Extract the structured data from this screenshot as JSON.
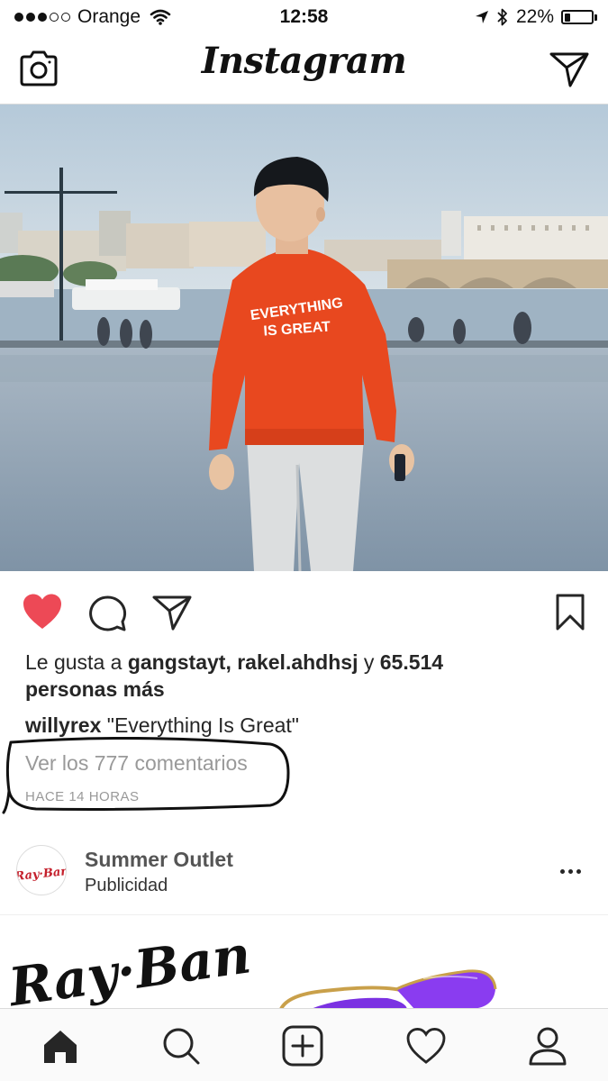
{
  "status_bar": {
    "carrier": "Orange",
    "time": "12:58",
    "battery": "22%",
    "battery_level": 0.22,
    "signal_bars_filled": 3,
    "signal_bars_total": 5
  },
  "header": {
    "logo": "Instagram"
  },
  "post": {
    "photo_shirt_text_line1": "EVERYTHING",
    "photo_shirt_text_line2": "IS GREAT",
    "liked": true,
    "likes_prefix": "Le gusta a",
    "likes_user1": "gangstayt",
    "likes_sep": ",",
    "likes_user2": "rakel.ahdhsj",
    "likes_and": "y",
    "likes_count": "65.514",
    "likes_suffix": "personas más",
    "author": "willyrex",
    "caption": "\"Everything Is Great\"",
    "view_comments": "Ver los 777 comentarios",
    "time_ago": "HACE 14 HORAS"
  },
  "sponsored": {
    "name": "Summer Outlet",
    "label": "Publicidad",
    "avatar_brand": "Ray-Ban",
    "ad_brand": "Ray-Ban"
  },
  "colors": {
    "like_red": "#ed4956",
    "annotation": "#111111",
    "lens_purple": "#8a3cf0"
  },
  "tab_bar": [
    "home",
    "search",
    "new-post",
    "activity",
    "profile"
  ]
}
